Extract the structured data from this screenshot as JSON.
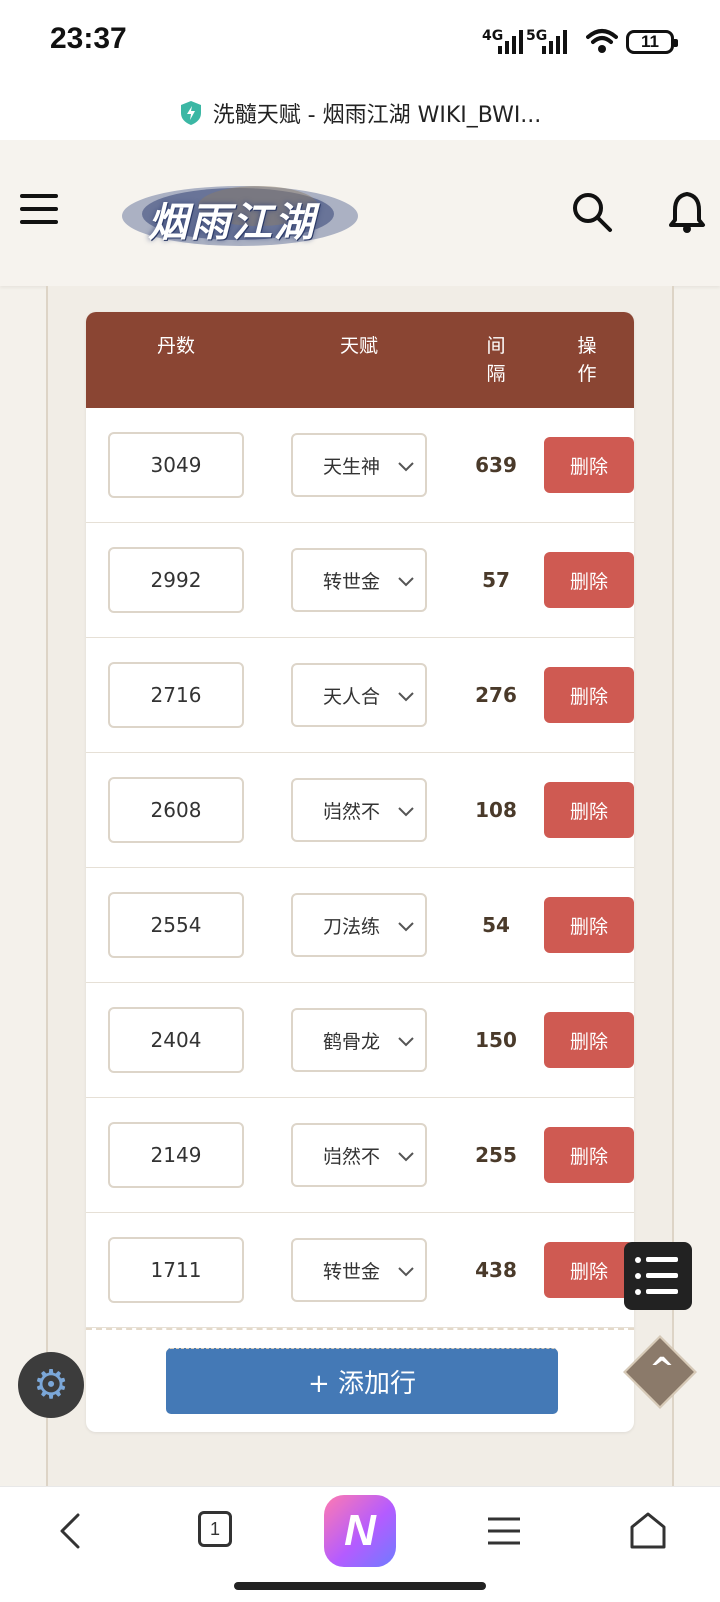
{
  "status": {
    "time": "23:37",
    "net1": "4G",
    "net2": "5G",
    "battery": "11"
  },
  "browser": {
    "page_title": "洗髓天赋 - 烟雨江湖 WIKI_BWI..."
  },
  "site": {
    "logo_text": "烟雨江湖"
  },
  "table": {
    "headers": {
      "dan": "丹数",
      "talent": "天赋",
      "gap": "间\n隔",
      "action": "操\n作"
    },
    "rows": [
      {
        "dan": "3049",
        "talent": "天生神",
        "gap": "639",
        "action": "删除"
      },
      {
        "dan": "2992",
        "talent": "转世金",
        "gap": "57",
        "action": "删除"
      },
      {
        "dan": "2716",
        "talent": "天人合",
        "gap": "276",
        "action": "删除"
      },
      {
        "dan": "2608",
        "talent": "岿然不",
        "gap": "108",
        "action": "删除"
      },
      {
        "dan": "2554",
        "talent": "刀法练",
        "gap": "54",
        "action": "删除"
      },
      {
        "dan": "2404",
        "talent": "鹤骨龙",
        "gap": "150",
        "action": "删除"
      },
      {
        "dan": "2149",
        "talent": "岿然不",
        "gap": "255",
        "action": "删除"
      },
      {
        "dan": "1711",
        "talent": "转世金",
        "gap": "438",
        "action": "删除"
      }
    ],
    "add_row_label": "+ 添加行"
  },
  "bottom_nav": {
    "tab_count": "1",
    "app_label": "N"
  },
  "colors": {
    "header_bg": "#8a4533",
    "delete_bg": "#cf5a52",
    "add_bg": "#4479b6"
  }
}
